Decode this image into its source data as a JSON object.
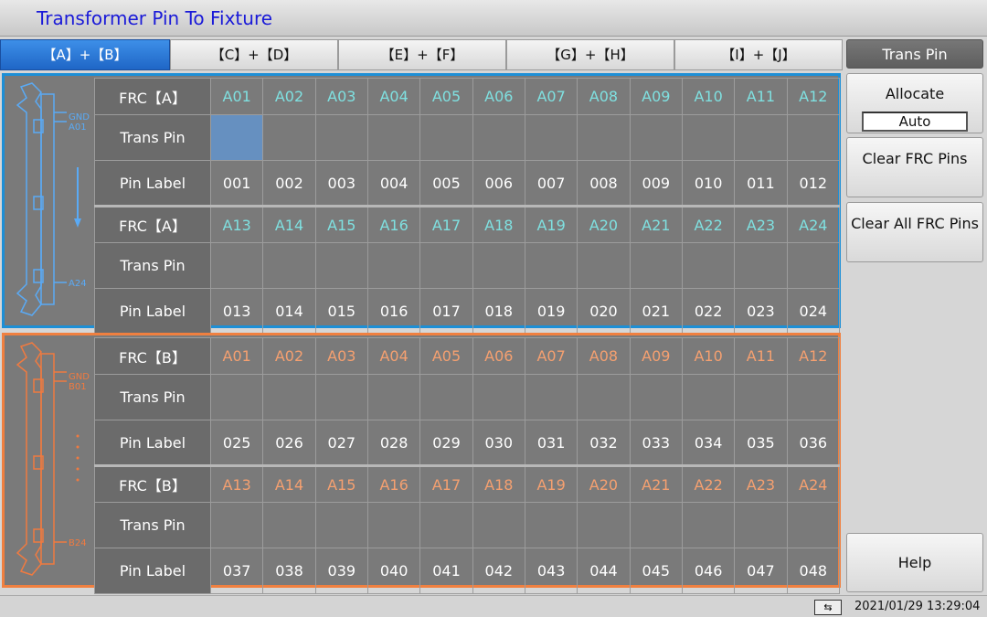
{
  "window": {
    "title": "Transformer Pin To Fixture"
  },
  "tabs": [
    {
      "label": "【A】+【B】",
      "active": true
    },
    {
      "label": "【C】+【D】",
      "active": false
    },
    {
      "label": "【E】+【F】",
      "active": false
    },
    {
      "label": "【G】+【H】",
      "active": false
    },
    {
      "label": "【I】+【J】",
      "active": false
    }
  ],
  "sidebar": {
    "title": "Trans Pin",
    "allocate_label": "Allocate",
    "allocate_mode": "Auto",
    "clear_frc_label": "Clear FRC Pins",
    "clear_all_label": "Clear All FRC Pins",
    "help_label": "Help"
  },
  "connector_labels": {
    "blue_top_gnd": "GND",
    "blue_top_pin": "A01",
    "blue_bottom_pin": "A24",
    "orange_top_gnd": "GND",
    "orange_top_pin": "B01",
    "orange_bottom_pin": "B24"
  },
  "row_labels": {
    "frc_a": "FRC【A】",
    "frc_b": "FRC【B】",
    "trans_pin": "Trans Pin",
    "pin_label": "Pin Label"
  },
  "panel_a": {
    "groups": [
      {
        "frc": [
          "A01",
          "A02",
          "A03",
          "A04",
          "A05",
          "A06",
          "A07",
          "A08",
          "A09",
          "A10",
          "A11",
          "A12"
        ],
        "labels": [
          "001",
          "002",
          "003",
          "004",
          "005",
          "006",
          "007",
          "008",
          "009",
          "010",
          "011",
          "012"
        ]
      },
      {
        "frc": [
          "A13",
          "A14",
          "A15",
          "A16",
          "A17",
          "A18",
          "A19",
          "A20",
          "A21",
          "A22",
          "A23",
          "A24"
        ],
        "labels": [
          "013",
          "014",
          "015",
          "016",
          "017",
          "018",
          "019",
          "020",
          "021",
          "022",
          "023",
          "024"
        ]
      }
    ]
  },
  "panel_b": {
    "groups": [
      {
        "frc": [
          "A01",
          "A02",
          "A03",
          "A04",
          "A05",
          "A06",
          "A07",
          "A08",
          "A09",
          "A10",
          "A11",
          "A12"
        ],
        "labels": [
          "025",
          "026",
          "027",
          "028",
          "029",
          "030",
          "031",
          "032",
          "033",
          "034",
          "035",
          "036"
        ]
      },
      {
        "frc": [
          "A13",
          "A14",
          "A15",
          "A16",
          "A17",
          "A18",
          "A19",
          "A20",
          "A21",
          "A22",
          "A23",
          "A24"
        ],
        "labels": [
          "037",
          "038",
          "039",
          "040",
          "041",
          "042",
          "043",
          "044",
          "045",
          "046",
          "047",
          "048"
        ]
      }
    ]
  },
  "status": {
    "datetime": "2021/01/29 13:29:04",
    "usb_icon": "usb-icon"
  },
  "colors": {
    "accent_blue": "#1d8fd6",
    "accent_orange": "#f08040",
    "selected_cell": "#6690c0"
  }
}
